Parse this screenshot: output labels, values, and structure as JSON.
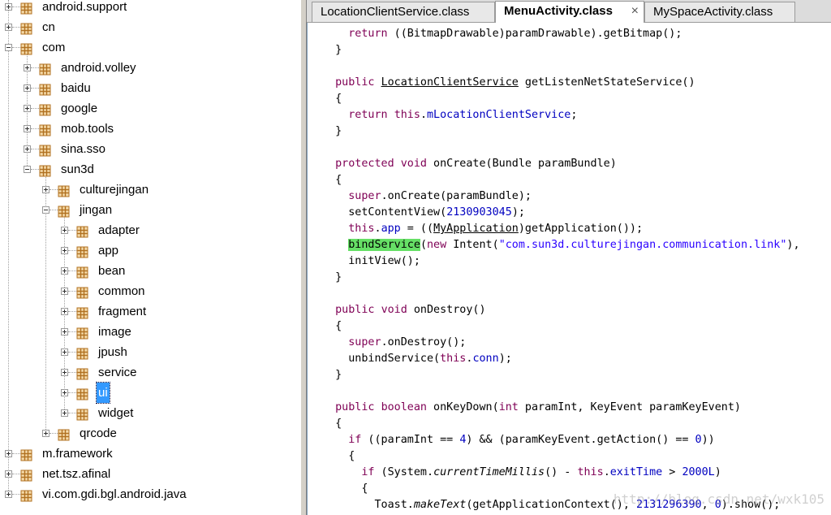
{
  "tree": {
    "nodes": [
      {
        "label": "android.support",
        "depth": 0,
        "expanded": false,
        "selected": false
      },
      {
        "label": "cn",
        "depth": 0,
        "expanded": false,
        "selected": false
      },
      {
        "label": "com",
        "depth": 0,
        "expanded": true,
        "selected": false
      },
      {
        "label": "android.volley",
        "depth": 1,
        "expanded": false,
        "selected": false
      },
      {
        "label": "baidu",
        "depth": 1,
        "expanded": false,
        "selected": false
      },
      {
        "label": "google",
        "depth": 1,
        "expanded": false,
        "selected": false
      },
      {
        "label": "mob.tools",
        "depth": 1,
        "expanded": false,
        "selected": false
      },
      {
        "label": "sina.sso",
        "depth": 1,
        "expanded": false,
        "selected": false
      },
      {
        "label": "sun3d",
        "depth": 1,
        "expanded": true,
        "selected": false
      },
      {
        "label": "culturejingan",
        "depth": 2,
        "expanded": false,
        "selected": false
      },
      {
        "label": "jingan",
        "depth": 2,
        "expanded": true,
        "selected": false
      },
      {
        "label": "adapter",
        "depth": 3,
        "expanded": false,
        "selected": false
      },
      {
        "label": "app",
        "depth": 3,
        "expanded": false,
        "selected": false
      },
      {
        "label": "bean",
        "depth": 3,
        "expanded": false,
        "selected": false
      },
      {
        "label": "common",
        "depth": 3,
        "expanded": false,
        "selected": false
      },
      {
        "label": "fragment",
        "depth": 3,
        "expanded": false,
        "selected": false
      },
      {
        "label": "image",
        "depth": 3,
        "expanded": false,
        "selected": false
      },
      {
        "label": "jpush",
        "depth": 3,
        "expanded": false,
        "selected": false
      },
      {
        "label": "service",
        "depth": 3,
        "expanded": false,
        "selected": false
      },
      {
        "label": "ui",
        "depth": 3,
        "expanded": false,
        "selected": true
      },
      {
        "label": "widget",
        "depth": 3,
        "expanded": false,
        "selected": false
      },
      {
        "label": "qrcode",
        "depth": 2,
        "expanded": false,
        "selected": false
      },
      {
        "label": "m.framework",
        "depth": 0,
        "expanded": false,
        "selected": false
      },
      {
        "label": "net.tsz.afinal",
        "depth": 0,
        "expanded": false,
        "selected": false
      },
      {
        "label": "vi.com.gdi.bgl.android.java",
        "depth": 0,
        "expanded": false,
        "selected": false
      }
    ],
    "package_icon": "package-icon",
    "colors": {
      "selection": "#3399ff",
      "package_icon": "#b07020"
    }
  },
  "tabs": [
    {
      "label": "LocationClientService.class",
      "active": false
    },
    {
      "label": "MenuActivity.class",
      "active": true,
      "close": "×"
    },
    {
      "label": "MySpaceActivity.class",
      "active": false
    }
  ],
  "code": {
    "lines": [
      [
        {
          "t": "    "
        },
        {
          "t": "return",
          "c": "kw"
        },
        {
          "t": " ((BitmapDrawable)paramDrawable).getBitmap();"
        }
      ],
      [
        {
          "t": "  }"
        }
      ],
      [
        {
          "t": ""
        }
      ],
      [
        {
          "t": "  "
        },
        {
          "t": "public",
          "c": "kw"
        },
        {
          "t": " "
        },
        {
          "t": "LocationClientService",
          "c": "ul"
        },
        {
          "t": " getListenNetStateService()"
        }
      ],
      [
        {
          "t": "  {"
        }
      ],
      [
        {
          "t": "    "
        },
        {
          "t": "return",
          "c": "kw"
        },
        {
          "t": " "
        },
        {
          "t": "this",
          "c": "kw"
        },
        {
          "t": "."
        },
        {
          "t": "mLocationClientService",
          "c": "fld"
        },
        {
          "t": ";"
        }
      ],
      [
        {
          "t": "  }"
        }
      ],
      [
        {
          "t": ""
        }
      ],
      [
        {
          "t": "  "
        },
        {
          "t": "protected",
          "c": "kw"
        },
        {
          "t": " "
        },
        {
          "t": "void",
          "c": "kw"
        },
        {
          "t": " onCreate(Bundle paramBundle)"
        }
      ],
      [
        {
          "t": "  {"
        }
      ],
      [
        {
          "t": "    "
        },
        {
          "t": "super",
          "c": "kw"
        },
        {
          "t": ".onCreate(paramBundle);"
        }
      ],
      [
        {
          "t": "    setContentView("
        },
        {
          "t": "2130903045",
          "c": "num"
        },
        {
          "t": ");"
        }
      ],
      [
        {
          "t": "    "
        },
        {
          "t": "this",
          "c": "kw"
        },
        {
          "t": "."
        },
        {
          "t": "app",
          "c": "fld"
        },
        {
          "t": " = (("
        },
        {
          "t": "MyApplication",
          "c": "ul"
        },
        {
          "t": ")getApplication());"
        }
      ],
      [
        {
          "t": "    "
        },
        {
          "t": "bindService",
          "c": "hl"
        },
        {
          "t": "("
        },
        {
          "t": "new",
          "c": "kw"
        },
        {
          "t": " Intent("
        },
        {
          "t": "\"com.sun3d.culturejingan.communication.link\"",
          "c": "str"
        },
        {
          "t": "),"
        }
      ],
      [
        {
          "t": "    initView();"
        }
      ],
      [
        {
          "t": "  }"
        }
      ],
      [
        {
          "t": ""
        }
      ],
      [
        {
          "t": "  "
        },
        {
          "t": "public",
          "c": "kw"
        },
        {
          "t": " "
        },
        {
          "t": "void",
          "c": "kw"
        },
        {
          "t": " onDestroy()"
        }
      ],
      [
        {
          "t": "  {"
        }
      ],
      [
        {
          "t": "    "
        },
        {
          "t": "super",
          "c": "kw"
        },
        {
          "t": ".onDestroy();"
        }
      ],
      [
        {
          "t": "    unbindService("
        },
        {
          "t": "this",
          "c": "kw"
        },
        {
          "t": "."
        },
        {
          "t": "conn",
          "c": "fld"
        },
        {
          "t": ");"
        }
      ],
      [
        {
          "t": "  }"
        }
      ],
      [
        {
          "t": ""
        }
      ],
      [
        {
          "t": "  "
        },
        {
          "t": "public",
          "c": "kw"
        },
        {
          "t": " "
        },
        {
          "t": "boolean",
          "c": "kw"
        },
        {
          "t": " onKeyDown("
        },
        {
          "t": "int",
          "c": "kw"
        },
        {
          "t": " paramInt, KeyEvent paramKeyEvent)"
        }
      ],
      [
        {
          "t": "  {"
        }
      ],
      [
        {
          "t": "    "
        },
        {
          "t": "if",
          "c": "kw"
        },
        {
          "t": " ((paramInt == "
        },
        {
          "t": "4",
          "c": "num"
        },
        {
          "t": ") && (paramKeyEvent.getAction() == "
        },
        {
          "t": "0",
          "c": "num"
        },
        {
          "t": "))"
        }
      ],
      [
        {
          "t": "    {"
        }
      ],
      [
        {
          "t": "      "
        },
        {
          "t": "if",
          "c": "kw"
        },
        {
          "t": " (System."
        },
        {
          "t": "currentTimeMillis",
          "c": "ital"
        },
        {
          "t": "() - "
        },
        {
          "t": "this",
          "c": "kw"
        },
        {
          "t": "."
        },
        {
          "t": "exitTime",
          "c": "fld"
        },
        {
          "t": " > "
        },
        {
          "t": "2000L",
          "c": "num"
        },
        {
          "t": ")"
        }
      ],
      [
        {
          "t": "      {"
        }
      ],
      [
        {
          "t": "        Toast."
        },
        {
          "t": "makeText",
          "c": "ital"
        },
        {
          "t": "(getApplicationContext(), "
        },
        {
          "t": "2131296390",
          "c": "num"
        },
        {
          "t": ", "
        },
        {
          "t": "0",
          "c": "num"
        },
        {
          "t": ").show();"
        }
      ]
    ],
    "colors": {
      "keyword": "#7f0055",
      "field": "#0000c0",
      "string": "#2a00ff",
      "highlight": "#66e066"
    }
  },
  "watermark": "http://blog.csdn.net/wxk105"
}
